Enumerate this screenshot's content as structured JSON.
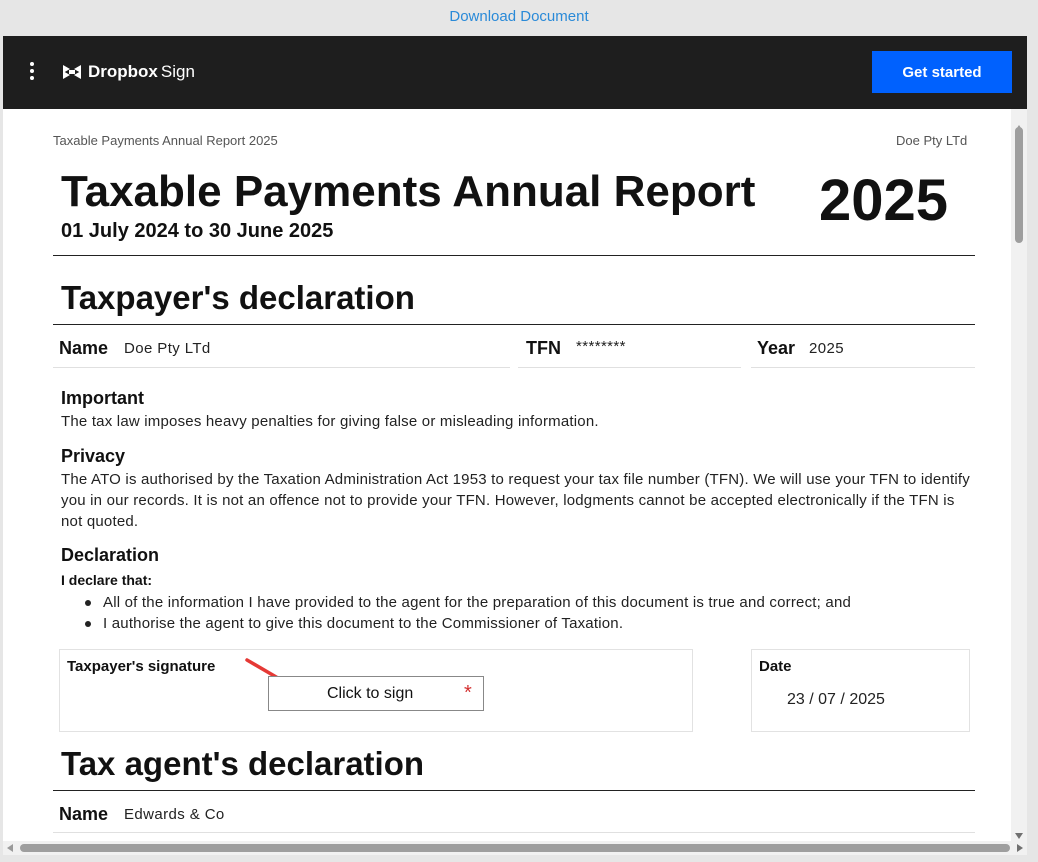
{
  "topbar": {
    "download_label": "Download Document"
  },
  "header": {
    "menu_icon": "kebab-menu-icon",
    "logo_bold": "Dropbox",
    "logo_light": "Sign",
    "get_started_label": "Get started",
    "accent": "#0061fe"
  },
  "document": {
    "running_title": "Taxable Payments Annual Report 2025",
    "running_company": "Doe Pty LTd",
    "title": "Taxable Payments Annual Report",
    "year": "2025",
    "period": "01 July 2024 to 30 June 2025",
    "taxpayer": {
      "heading": "Taxpayer's declaration",
      "name_label": "Name",
      "name_value": "Doe Pty LTd",
      "tfn_label": "TFN",
      "tfn_value": "********",
      "year_label": "Year",
      "year_value": "2025",
      "important_heading": "Important",
      "important_text": "The tax law imposes heavy penalties for giving false or misleading information.",
      "privacy_heading": "Privacy",
      "privacy_text": "The ATO is authorised by the Taxation Administration Act 1953 to request your tax file number (TFN). We will use your TFN to identify you in our records. It is not an offence not to provide your TFN. However, lodgments cannot be accepted electronically if the TFN is not quoted.",
      "declaration_heading": "Declaration",
      "declare_intro": "I declare that:",
      "declarations": [
        "All of the information I have provided to the agent for the preparation of this document is true and correct; and",
        "I authorise the agent to give this document to the Commissioner of Taxation."
      ],
      "signature_label": "Taxpayer's signature",
      "sign_button_label": "Click to sign",
      "required_mark": "*",
      "date_label": "Date",
      "date_day": "23",
      "date_month": "07",
      "date_year": "2025",
      "date_sep": "/"
    },
    "agent": {
      "heading": "Tax agent's declaration",
      "name_label": "Name",
      "name_value": "Edwards & Co"
    }
  }
}
